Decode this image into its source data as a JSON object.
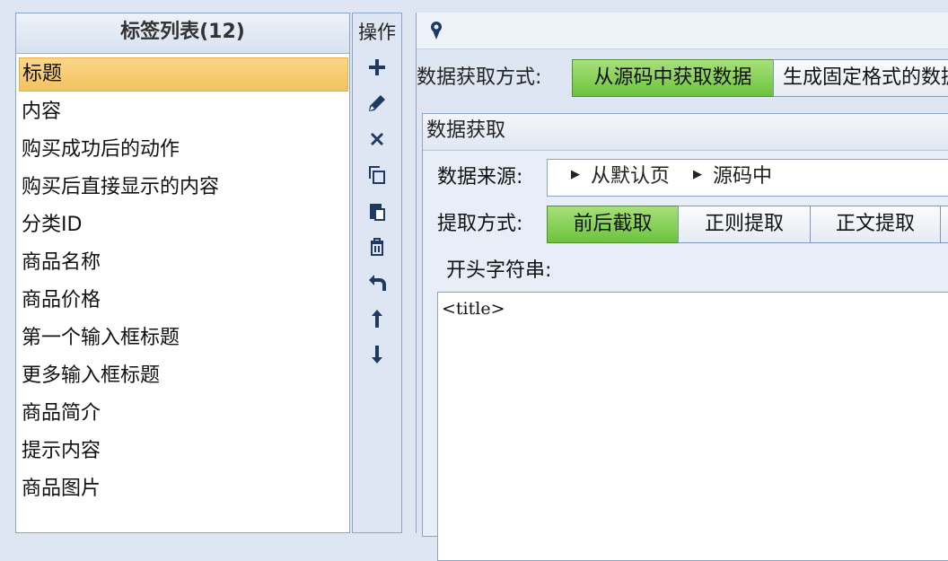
{
  "tag_panel": {
    "header": "标签列表(12)",
    "items": [
      {
        "label": "标题",
        "selected": true
      },
      {
        "label": "内容"
      },
      {
        "label": "购买成功后的动作"
      },
      {
        "label": "购买后直接显示的内容"
      },
      {
        "label": "分类ID"
      },
      {
        "label": "商品名称"
      },
      {
        "label": "商品价格"
      },
      {
        "label": "第一个输入框标题"
      },
      {
        "label": "更多输入框标题"
      },
      {
        "label": "商品简介"
      },
      {
        "label": "提示内容"
      },
      {
        "label": "商品图片"
      }
    ]
  },
  "ops": {
    "title": "操作",
    "buttons": [
      "plus-icon",
      "pencil-icon",
      "delete-icon",
      "copy-icon",
      "paste-icon",
      "trash-icon",
      "undo-icon",
      "arrow-up-icon",
      "arrow-down-icon"
    ]
  },
  "right": {
    "mode_label": "数据获取方式:",
    "mode_tabs": [
      "从源码中获取数据",
      "生成固定格式的数据"
    ],
    "group_title": "数据获取",
    "source_label": "数据来源:",
    "source_crumbs": [
      "从默认页",
      "源码中"
    ],
    "method_label": "提取方式:",
    "method_tabs": [
      "前后截取",
      "正则提取",
      "正文提取"
    ],
    "start_label": "开头字符串:",
    "start_value": "<title>"
  },
  "colors": {
    "selected_item": "#f3c25f",
    "active_tab_green": "#6cc33e",
    "panel_border": "#8ea4c2",
    "background": "#dde6f2"
  }
}
